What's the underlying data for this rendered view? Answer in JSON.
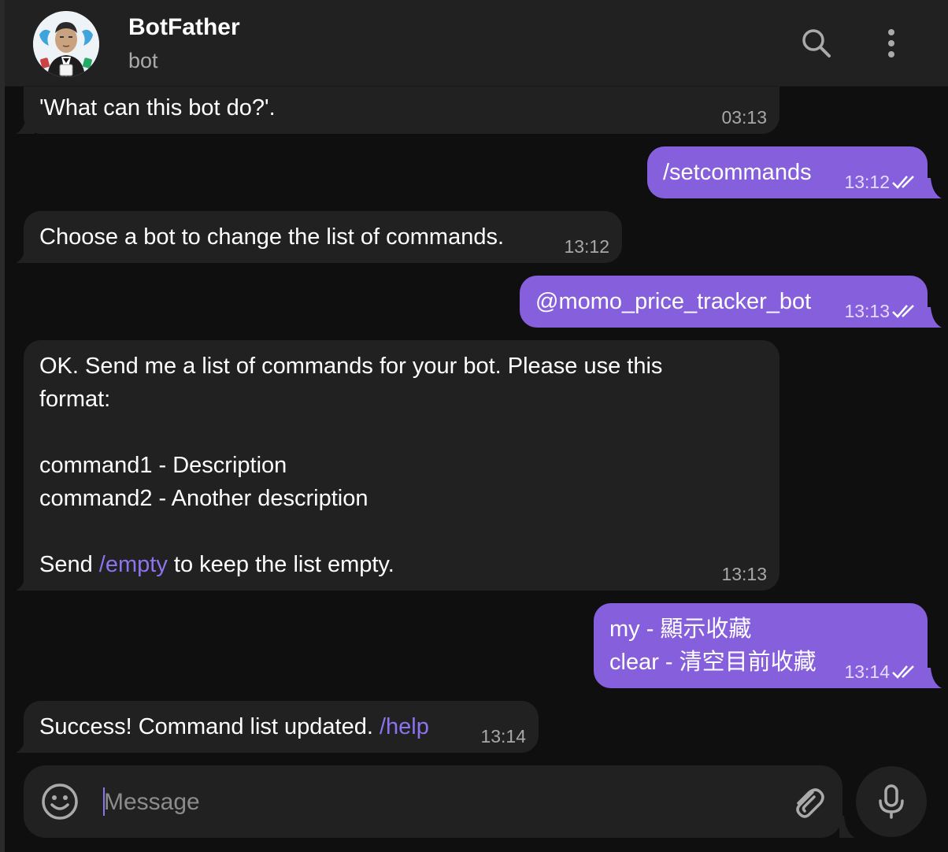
{
  "header": {
    "title": "BotFather",
    "subtitle": "bot"
  },
  "messages": [
    {
      "dir": "in",
      "text": "'What can this bot do?'.",
      "time": "03:13"
    },
    {
      "dir": "out",
      "text": "/setcommands",
      "time": "13:12",
      "read": true
    },
    {
      "dir": "in",
      "text": "Choose a bot to change the list of commands.",
      "time": "13:12"
    },
    {
      "dir": "out",
      "text": "@momo_price_tracker_bot",
      "time": "13:13",
      "read": true
    },
    {
      "dir": "in",
      "lines": [
        "OK. Send me a list of commands for your bot. Please use this",
        "format:",
        "",
        "command1 - Description",
        "command2 - Another description",
        ""
      ],
      "last_line_pre": "Send ",
      "last_line_link": "/empty",
      "last_line_post": " to keep the list empty.",
      "time": "13:13"
    },
    {
      "dir": "out",
      "lines": [
        "my - 顯示收藏",
        "clear - 清空目前收藏"
      ],
      "time": "13:14",
      "read": true
    },
    {
      "dir": "in",
      "text_pre": "Success! Command list updated. ",
      "text_link": "/help",
      "time": "13:14"
    }
  ],
  "composer": {
    "placeholder": "Message"
  },
  "icons": {
    "search": "search-icon",
    "more": "more-vertical-icon",
    "emoji": "emoji-icon",
    "attach": "paperclip-icon",
    "mic": "microphone-icon",
    "read_receipt": "double-check-icon"
  },
  "colors": {
    "accent": "#8660dc",
    "link": "#8e73ef",
    "incoming_bubble": "#212121",
    "background": "#0f0f0f"
  }
}
